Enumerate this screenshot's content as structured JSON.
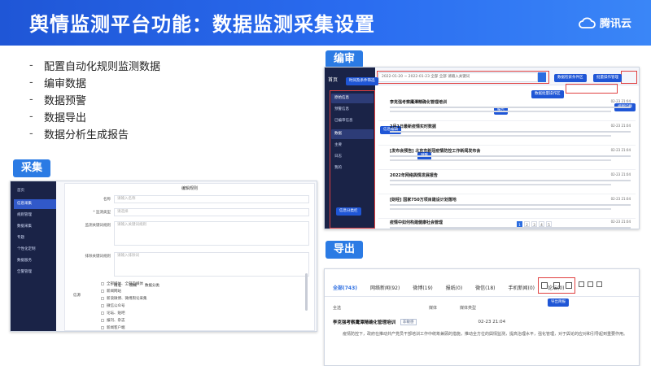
{
  "header": {
    "title": "舆情监测平台功能：数据监测采集设置",
    "brand": "腾讯云",
    "brand_icon": "cloud-logo-icon"
  },
  "bullets": [
    "配置自动化规则监测数据",
    "编审数据",
    "数据预警",
    "数据导出",
    "数据分析生成报告"
  ],
  "tags": {
    "collect": "采集",
    "edit": "编审",
    "export": "导出"
  },
  "editor": {
    "search_text": "2022-01-20 ~ 2022-01-23  全部  全部  请输入关键词",
    "sidebar": [
      "首页",
      "原始信息",
      "预警信息",
      "已编审信息",
      "数据",
      "主要",
      "日志",
      "我的"
    ],
    "callouts": {
      "time_filter": "时间及条件筛选",
      "info_filter": "数据检索条件区",
      "batch_mgmt": "批量操作管理",
      "batch_op": "数据批量操作区",
      "view_switch": "视图切换",
      "report": "报告",
      "quick_edit": "信息编辑",
      "alert": "预警",
      "data_center": "信息分类栏"
    },
    "rows": [
      {
        "title": "李克强考察鹰潭精确化管理培训",
        "meta": "02-23 21:04"
      },
      {
        "title": "2月1日最新疫情实时数据",
        "meta": "02-23 21:04"
      },
      {
        "title": "[发布会预告] 北京市新冠疫情防控工作新闻发布会",
        "meta": "02-23 21:04"
      },
      {
        "title": "2022年网络舆情发展报告",
        "meta": "02-23 21:04"
      },
      {
        "title": "[财经] 国家750万项目建设计划落地",
        "meta": "02-23 21:04"
      },
      {
        "title": "疫情中如何构建健康社会管理",
        "meta": "02-23 21:04"
      }
    ],
    "pages": [
      "1",
      "2",
      "3",
      "4",
      "5"
    ]
  },
  "export": {
    "tabs": [
      "全部(743)",
      "网络新闻(92)",
      "微博(19)",
      "报纸(0)",
      "微信(18)",
      "手机新闻(0)",
      "论坛(0)"
    ],
    "export_label": "导出简报",
    "select_all": "全选",
    "col_source": "媒体",
    "col_type": "媒体类型",
    "row_title": "李克强考察鹰潭精确化管理培训",
    "row_chip": "非敏感",
    "row_time": "02-23 21:04",
    "row_text": "疫情防控下，政府在推动共产党员干部培训工作中统筹兼顾的措施，推动全方位的舆情监测，提高治理水平，强化管理，对于舆论的应对和引导起到重要作用。"
  },
  "collect": {
    "modal_title": "编辑规则",
    "sidebar": [
      "首页",
      "信息采集",
      "规则管理",
      "数据采集",
      "专题",
      "个性化定制",
      "数据服务",
      "告警管理"
    ],
    "fields": [
      {
        "label": "名称",
        "placeholder": "请输入名称"
      },
      {
        "label": "* 监测类型",
        "placeholder": "请选择"
      },
      {
        "label": "监测关键词规则",
        "placeholder": "请输入关键词规则"
      },
      {
        "label": "排除关键词规则",
        "placeholder": "请输入排除词"
      }
    ],
    "tabs": [
      "精准",
      "模糊",
      "数据分类"
    ],
    "list_label": "信源",
    "list": [
      "全部媒体、全部自媒体",
      "新闻网站",
      "新浪微博、微博舆论采集",
      "微信公众号",
      "论坛、贴吧",
      "报刊、杂志",
      "新闻客户端",
      "视频网站",
      "短视频"
    ]
  }
}
